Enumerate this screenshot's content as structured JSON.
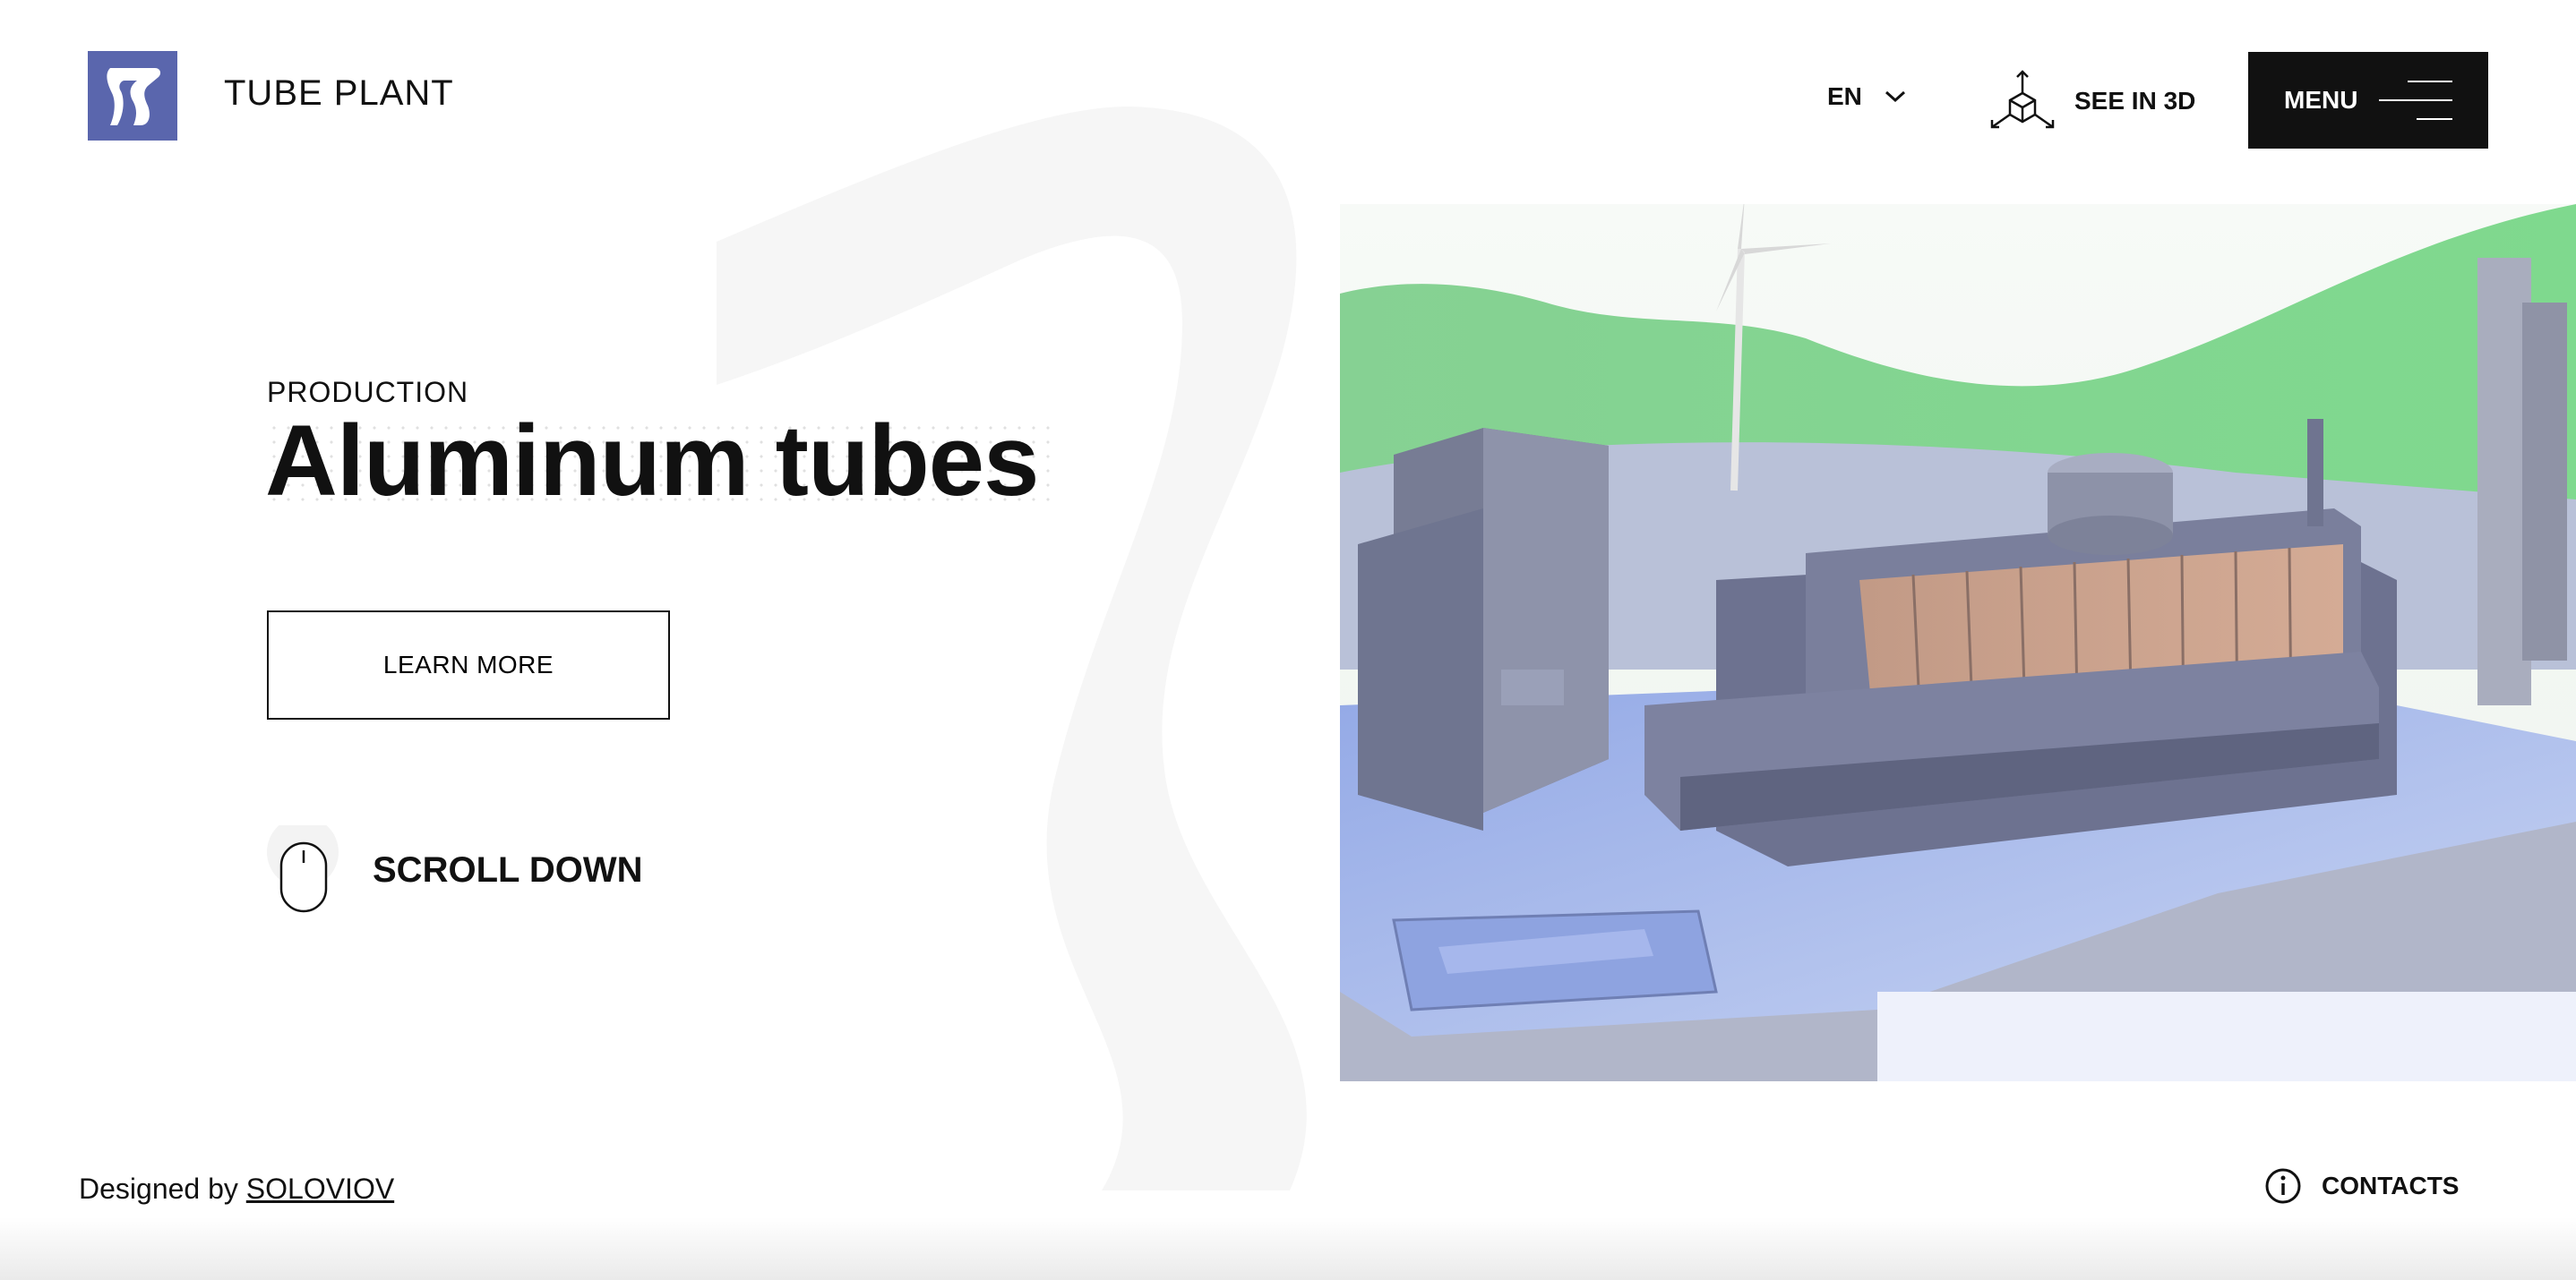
{
  "brand": {
    "name": "TUBE PLANT",
    "logo_icon": "tube-logo-icon",
    "logo_color": "#5a66ad"
  },
  "header": {
    "language": "EN",
    "see_in_3d": "SEE IN 3D",
    "menu": "MENU"
  },
  "hero": {
    "eyebrow": "PRODUCTION",
    "title": "Aluminum tubes",
    "learn_more": "LEARN MORE",
    "scroll_down": "SCROLL DOWN"
  },
  "footer": {
    "designed_by": "Designed by",
    "designer": "SOLOVIOV",
    "contacts": "CONTACTS"
  },
  "icons": {
    "language": "chevron-down-icon",
    "see_in_3d": "cube-3d-icon",
    "menu": "hamburger-icon",
    "scroll": "mouse-icon",
    "contacts": "info-icon"
  },
  "colors": {
    "accent": "#5a66ad",
    "menu_bg": "#111111",
    "scene_grass": "#8fd49a",
    "scene_building": "#7f8fc0"
  }
}
